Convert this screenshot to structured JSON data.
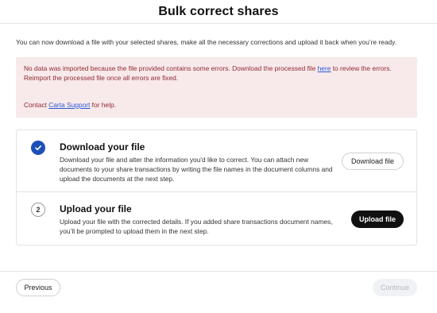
{
  "header": {
    "title": "Bulk correct shares"
  },
  "intro": {
    "text": "You can now download a file with your selected shares, make all the necessary corrections and upload it back when you’re ready."
  },
  "error": {
    "part1": "No data was imported because the file provided contains some errors. Download the processed file ",
    "link": "here",
    "part2": " to review the errors.",
    "line2": "Reimport the processed file once all errors are fixed.",
    "contact_prefix": "Contact ",
    "contact_link": "Carta Support",
    "contact_suffix": " for help.",
    "colors": {
      "background": "#f8e9ea",
      "text": "#8e2b33",
      "link": "#2a5bd7"
    }
  },
  "steps": [
    {
      "status": "complete",
      "icon": "checkmark-icon",
      "title": "Download your file",
      "description": "Download your file and alter the information you'd like to correct. You can attach new documents to your share transactions by writing the file names in the document columns and upload the documents at the next step.",
      "button": "Download file"
    },
    {
      "status": "current",
      "number": "2",
      "title": "Upload your file",
      "description": "Upload your file with the corrected details. If you added share transactions document names, you’ll be prompted to upload them in the next step.",
      "button": "Upload file"
    }
  ],
  "footer": {
    "previous": "Previous",
    "continue": "Continue"
  },
  "colors": {
    "accent": "#1d4fb8",
    "primary_button": "#101010"
  }
}
